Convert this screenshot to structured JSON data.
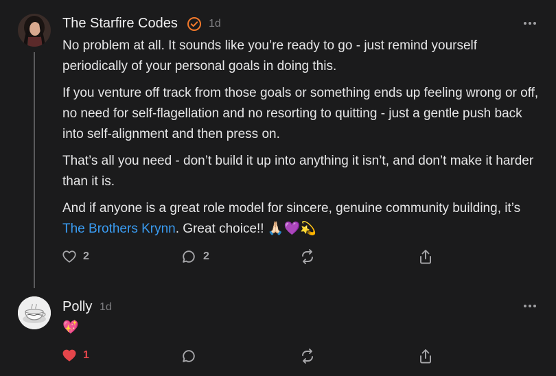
{
  "comments": [
    {
      "author": "The Starfire Codes",
      "age": "1d",
      "verified": true,
      "paragraphs": [
        "No problem at all. It sounds like you’re ready to go - just remind yourself periodically of your personal goals in doing this.",
        "If you venture off track from those goals or something ends up feeling wrong or off, no need for self-flagellation and no resorting to quitting - just a gentle push back into self-alignment and then press on.",
        "That’s all you need - don’t build it up into anything it isn’t, and don’t make it harder than it is."
      ],
      "last_paragraph": {
        "before_link": "And if anyone is a great role model for sincere, genuine community building, it’s ",
        "link_text": "The Brothers Krynn",
        "after_link": ". Great choice!! ",
        "emojis": "🙏🏻💜💫"
      },
      "likes": "2",
      "replies": "2",
      "liked": false
    },
    {
      "author": "Polly",
      "age": "1d",
      "verified": false,
      "emoji_body": "💖",
      "likes": "1",
      "replies": "",
      "liked": true
    }
  ],
  "colors": {
    "background": "#1b1b1c",
    "link": "#3a9cf2",
    "verified": "#f3792b",
    "liked": "#e5464b",
    "muted": "#a8a8ab"
  },
  "icons": {
    "like": "heart-icon",
    "reply": "speech-bubble-icon",
    "restack": "restack-icon",
    "share": "share-icon",
    "more": "more-icon",
    "verified": "verified-check-icon"
  }
}
